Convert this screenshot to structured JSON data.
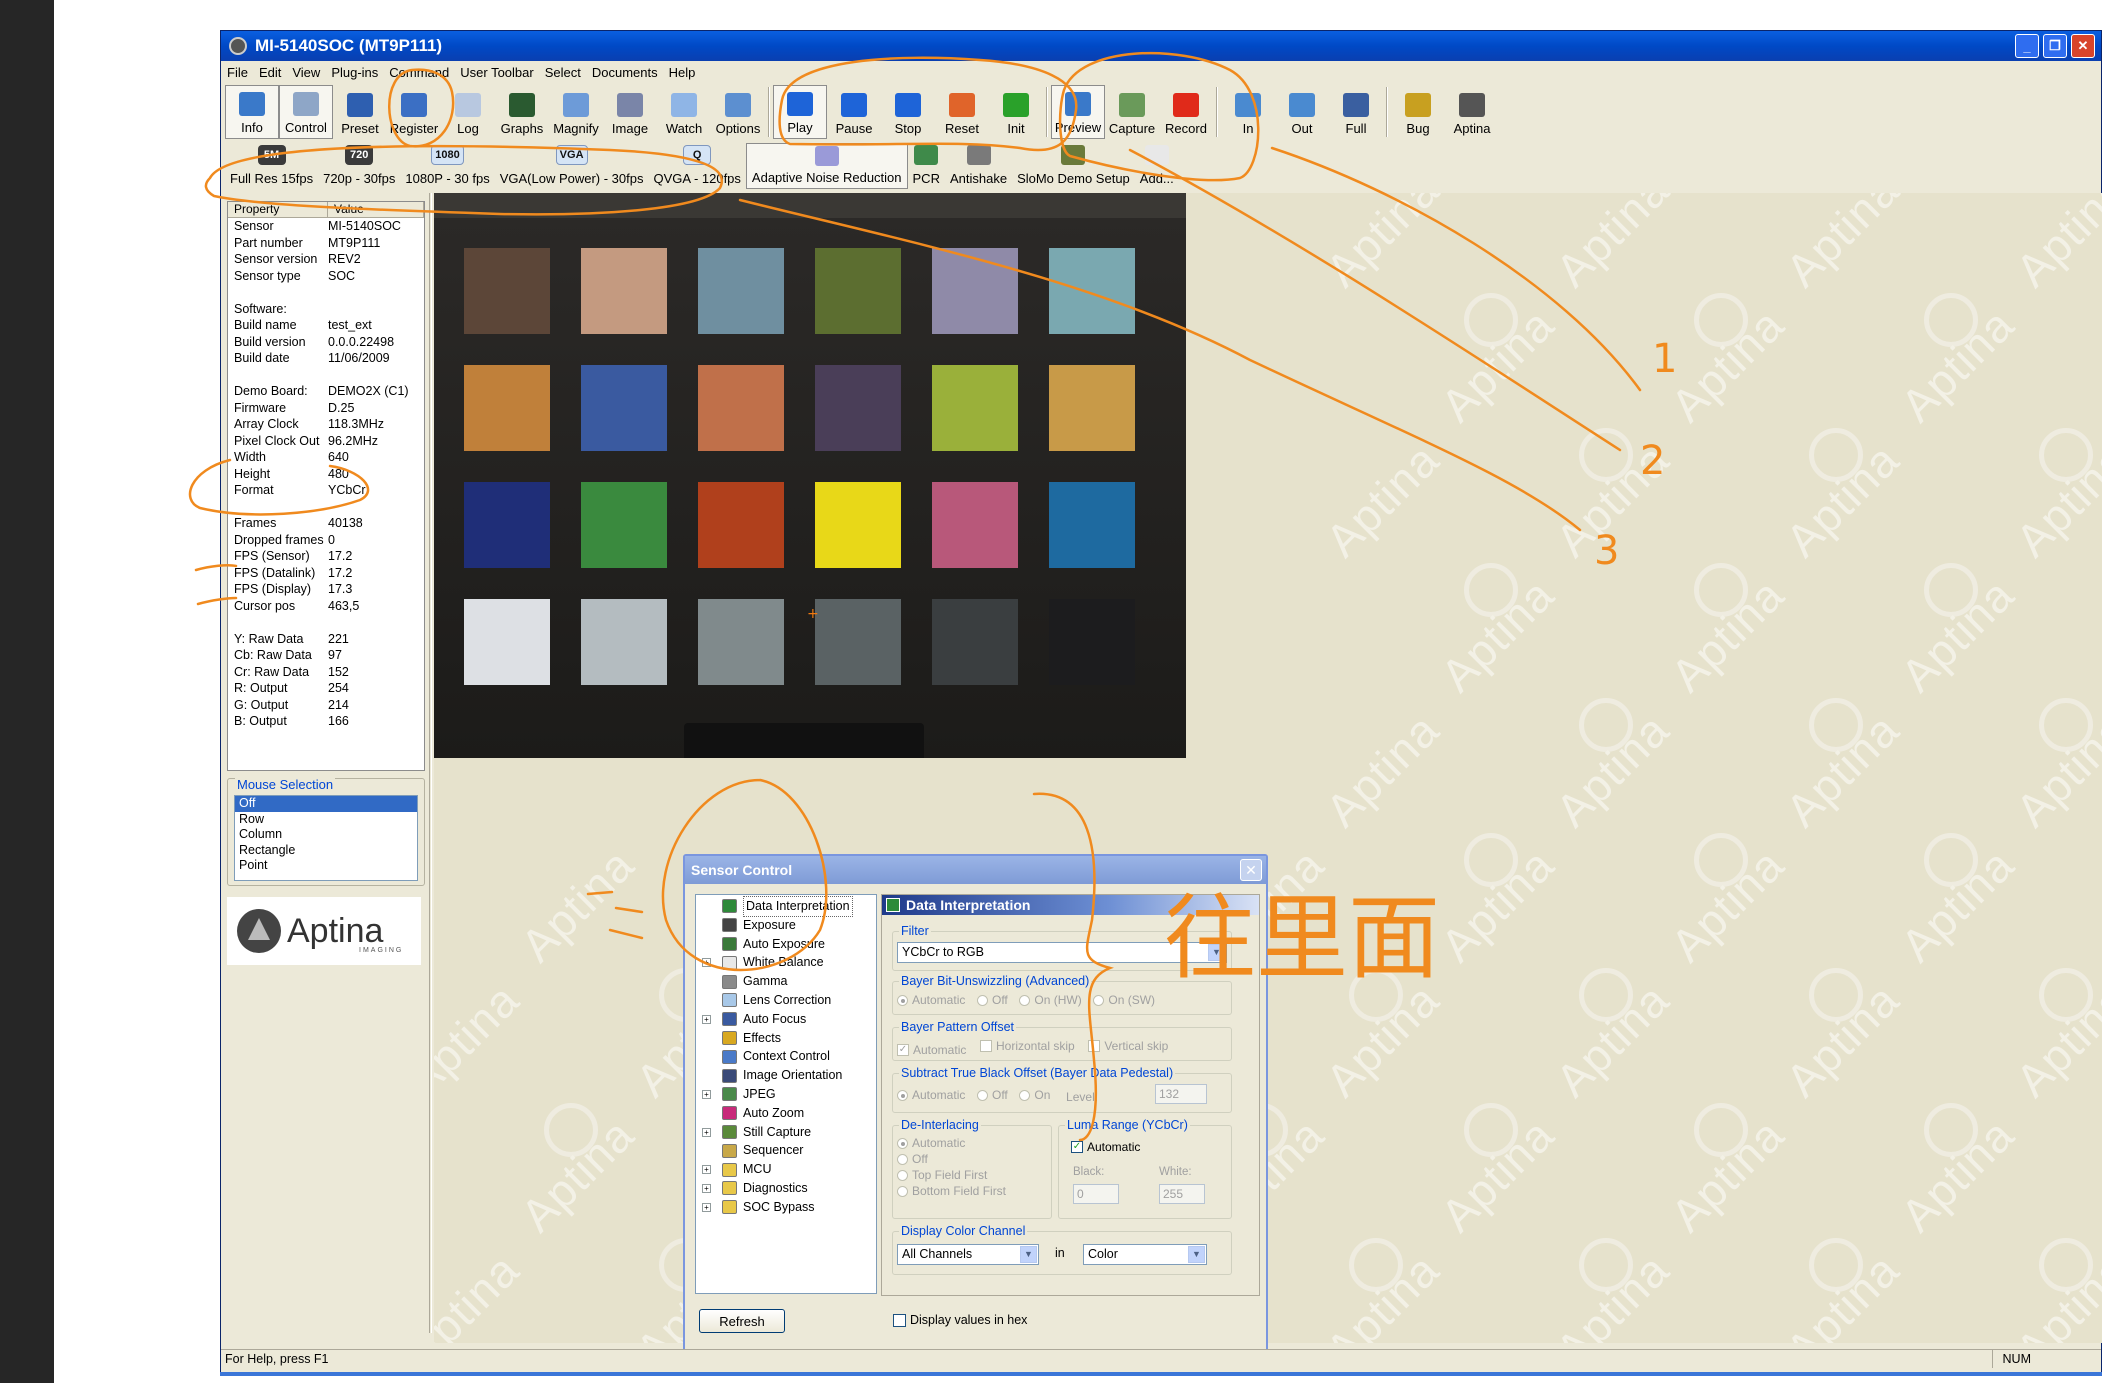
{
  "window": {
    "title": "MI-5140SOC (MT9P111)",
    "controls": [
      "_",
      "❐",
      "✕"
    ]
  },
  "menu": [
    "File",
    "Edit",
    "View",
    "Plug-ins",
    "Command",
    "User Toolbar",
    "Select",
    "Documents",
    "Help"
  ],
  "toolbar": [
    {
      "label": "Info",
      "icon": "info-icon",
      "color": "#3a79c9",
      "pressed": true
    },
    {
      "label": "Control",
      "icon": "gear-icon",
      "color": "#8ea6c7",
      "pressed": true
    },
    {
      "label": "Preset",
      "icon": "floppy-icon",
      "color": "#2e5fb0",
      "pressed": false
    },
    {
      "label": "Register",
      "icon": "register-icon",
      "color": "#3b6fc4",
      "pressed": false
    },
    {
      "label": "Log",
      "icon": "log-icon",
      "color": "#b8c8e0",
      "pressed": false
    },
    {
      "label": "Graphs",
      "icon": "graph-icon",
      "color": "#2a5a30",
      "pressed": false
    },
    {
      "label": "Magnify",
      "icon": "magnify-icon",
      "color": "#6d9bd8",
      "pressed": false
    },
    {
      "label": "Image",
      "icon": "image-icon",
      "color": "#7a85a8",
      "pressed": false
    },
    {
      "label": "Watch",
      "icon": "eye-icon",
      "color": "#8fb5e6",
      "pressed": false
    },
    {
      "label": "Options",
      "icon": "options-icon",
      "color": "#5c8fd0",
      "pressed": false
    },
    {
      "sep": true
    },
    {
      "label": "Play",
      "icon": "play-icon",
      "color": "#1e64d8",
      "pressed": true
    },
    {
      "label": "Pause",
      "icon": "pause-icon",
      "color": "#1e64d8",
      "pressed": false
    },
    {
      "label": "Stop",
      "icon": "stop-icon",
      "color": "#1e64d8",
      "pressed": false
    },
    {
      "label": "Reset",
      "icon": "reset-icon",
      "color": "#e0642a",
      "pressed": false
    },
    {
      "label": "Init",
      "icon": "check-icon",
      "color": "#2aa12a",
      "pressed": false
    },
    {
      "sep": true
    },
    {
      "label": "Preview",
      "icon": "preview-icon",
      "color": "#3a79c9",
      "pressed": true
    },
    {
      "label": "Capture",
      "icon": "capture-icon",
      "color": "#6a9a5a",
      "pressed": false
    },
    {
      "label": "Record",
      "icon": "record-icon",
      "color": "#e02a1a",
      "pressed": false
    },
    {
      "sep": true
    },
    {
      "label": "In",
      "icon": "zoom-in-icon",
      "color": "#4a8ad0",
      "pressed": false
    },
    {
      "label": "Out",
      "icon": "zoom-out-icon",
      "color": "#4a8ad0",
      "pressed": false
    },
    {
      "label": "Full",
      "icon": "full-icon",
      "color": "#3a5fa0",
      "pressed": false
    },
    {
      "sep": true
    },
    {
      "label": "Bug",
      "icon": "bug-icon",
      "color": "#c8a020",
      "pressed": false
    },
    {
      "label": "Aptina",
      "icon": "aptina-icon",
      "color": "#555555",
      "pressed": false
    }
  ],
  "toolbar2": [
    {
      "label": "Full Res 15fps",
      "badge": "5M",
      "style": "dark"
    },
    {
      "label": "720p - 30fps",
      "badge": "720",
      "style": "dark"
    },
    {
      "label": "1080P - 30 fps",
      "badge": "1080",
      "style": "light"
    },
    {
      "label": "VGA(Low Power) - 30fps",
      "badge": "VGA",
      "style": "light"
    },
    {
      "label": "QVGA - 120fps",
      "badge": "Q",
      "style": "light"
    },
    {
      "label": "Adaptive Noise Reduction",
      "icon": "eraser-icon",
      "color": "#9a9ad8",
      "pressed": true
    },
    {
      "label": "PCR",
      "icon": "pcr-icon",
      "color": "#3f8a4a"
    },
    {
      "label": "Antishake",
      "icon": "antishake-icon",
      "color": "#7a7a7a"
    },
    {
      "label": "SloMo Demo Setup",
      "icon": "turtle-icon",
      "color": "#6a7a3a"
    },
    {
      "label": "Add...",
      "icon": "add-icon",
      "color": "#e8e8e8"
    }
  ],
  "properties": {
    "header": [
      "Property",
      "Value"
    ],
    "rows": [
      [
        "Sensor",
        "MI-5140SOC"
      ],
      [
        "Part number",
        "MT9P111"
      ],
      [
        "Sensor version",
        "REV2"
      ],
      [
        "Sensor type",
        "SOC"
      ],
      [
        "",
        ""
      ],
      [
        "Software:",
        ""
      ],
      [
        "Build name",
        "test_ext"
      ],
      [
        "Build version",
        "0.0.0.22498"
      ],
      [
        "Build date",
        "11/06/2009"
      ],
      [
        "",
        ""
      ],
      [
        "Demo Board:",
        "DEMO2X (C1)"
      ],
      [
        "Firmware",
        "D.25"
      ],
      [
        "Array Clock",
        "118.3MHz"
      ],
      [
        "Pixel Clock Out",
        "96.2MHz"
      ],
      [
        "Width",
        "640"
      ],
      [
        "Height",
        "480"
      ],
      [
        "Format",
        "YCbCr"
      ],
      [
        "",
        ""
      ],
      [
        "Frames",
        "40138"
      ],
      [
        "Dropped frames",
        "0"
      ],
      [
        "FPS (Sensor)",
        "17.2"
      ],
      [
        "FPS (Datalink)",
        "17.2"
      ],
      [
        "FPS (Display)",
        "17.3"
      ],
      [
        "Cursor pos",
        "463,5"
      ],
      [
        "",
        ""
      ],
      [
        "Y: Raw Data",
        "221"
      ],
      [
        "Cb: Raw Data",
        "97"
      ],
      [
        "Cr: Raw Data",
        "152"
      ],
      [
        "R: Output",
        "254"
      ],
      [
        "G: Output",
        "214"
      ],
      [
        "B: Output",
        "166"
      ]
    ]
  },
  "mouse_selection": {
    "title": "Mouse Selection",
    "options": [
      "Off",
      "Row",
      "Column",
      "Rectangle",
      "Point"
    ],
    "selected": "Off"
  },
  "logo": {
    "text": "Aptina",
    "sub": "IMAGING"
  },
  "watermark": "Aptina",
  "color_checker": [
    [
      "#5c4638",
      "#c49a80",
      "#6f8fa0",
      "#5c6e30",
      "#8f8aa8",
      "#7aa8b0"
    ],
    [
      "#c0803a",
      "#3a5aa0",
      "#c0704a",
      "#4a3e58",
      "#9ab03a",
      "#c89a48"
    ],
    [
      "#1f2e78",
      "#3a8a3e",
      "#b0401c",
      "#e8d818",
      "#b8587a",
      "#1e6aa0"
    ],
    [
      "#dde0e4",
      "#b4bcc0",
      "#808a8c",
      "#5a6264",
      "#3a3e40",
      "#1c1c1e"
    ]
  ],
  "sensor_control": {
    "title": "Sensor Control",
    "tree": [
      {
        "label": "Data Interpretation",
        "icon": "data-interp-icon",
        "color": "#2e8a3a",
        "expand": false,
        "selected": true
      },
      {
        "label": "Exposure",
        "icon": "exposure-icon",
        "color": "#444444",
        "expand": false
      },
      {
        "label": "Auto Exposure",
        "icon": "auto-exposure-icon",
        "color": "#3a7a3a",
        "expand": false
      },
      {
        "label": "White Balance",
        "icon": "white-balance-icon",
        "color": "#e8e8e8",
        "expand": true
      },
      {
        "label": "Gamma",
        "icon": "gamma-icon",
        "color": "#8a8a8a",
        "expand": false
      },
      {
        "label": "Lens Correction",
        "icon": "lens-icon",
        "color": "#a8c8e8",
        "expand": false
      },
      {
        "label": "Auto Focus",
        "icon": "auto-focus-icon",
        "color": "#3a5aa0",
        "expand": true
      },
      {
        "label": "Effects",
        "icon": "effects-icon",
        "color": "#d8a820",
        "expand": false
      },
      {
        "label": "Context Control",
        "icon": "context-icon",
        "color": "#4a7ac8",
        "expand": false
      },
      {
        "label": "Image Orientation",
        "icon": "orientation-icon",
        "color": "#3a4a78",
        "expand": false
      },
      {
        "label": "JPEG",
        "icon": "jpeg-icon",
        "color": "#4a8a4a",
        "expand": true
      },
      {
        "label": "Auto Zoom",
        "icon": "auto-zoom-icon",
        "color": "#c82a7a",
        "expand": false
      },
      {
        "label": "Still Capture",
        "icon": "still-capture-icon",
        "color": "#5a8a3a",
        "expand": true
      },
      {
        "label": "Sequencer",
        "icon": "sequencer-icon",
        "color": "#c8a848",
        "expand": false
      },
      {
        "label": "MCU",
        "icon": "folder-icon",
        "color": "#e8c848",
        "expand": true
      },
      {
        "label": "Diagnostics",
        "icon": "folder-icon",
        "color": "#e8c848",
        "expand": true
      },
      {
        "label": "SOC Bypass",
        "icon": "folder-icon",
        "color": "#e8c848",
        "expand": true
      }
    ],
    "panel_title": "Data Interpretation",
    "filter": {
      "label": "Filter",
      "value": "YCbCr to RGB"
    },
    "bayer_unswizzle": {
      "label": "Bayer Bit-Unswizzling (Advanced)",
      "options": [
        "Automatic",
        "Off",
        "On (HW)",
        "On (SW)"
      ]
    },
    "bayer_offset": {
      "label": "Bayer Pattern Offset",
      "options": [
        "Automatic",
        "Horizontal skip",
        "Vertical skip"
      ]
    },
    "black_offset": {
      "label": "Subtract True Black Offset (Bayer Data Pedestal)",
      "options": [
        "Automatic",
        "Off",
        "On"
      ],
      "level_label": "Level:",
      "level": "132"
    },
    "deinterlacing": {
      "label": "De-Interlacing",
      "options": [
        "Automatic",
        "Off",
        "Top Field First",
        "Bottom Field First"
      ]
    },
    "luma_range": {
      "label": "Luma Range (YCbCr)",
      "automatic": "Automatic",
      "black_label": "Black:",
      "black": "0",
      "white_label": "White:",
      "white": "255"
    },
    "display_channel": {
      "label": "Display Color Channel",
      "channel": "All Channels",
      "in": "in",
      "mode": "Color"
    },
    "refresh": "Refresh",
    "hex": "Display values in hex"
  },
  "status": {
    "help": "For Help, press F1",
    "num": "NUM"
  },
  "annotations": {
    "n1": "1",
    "n2": "2",
    "n3": "3",
    "note": "往里面"
  }
}
